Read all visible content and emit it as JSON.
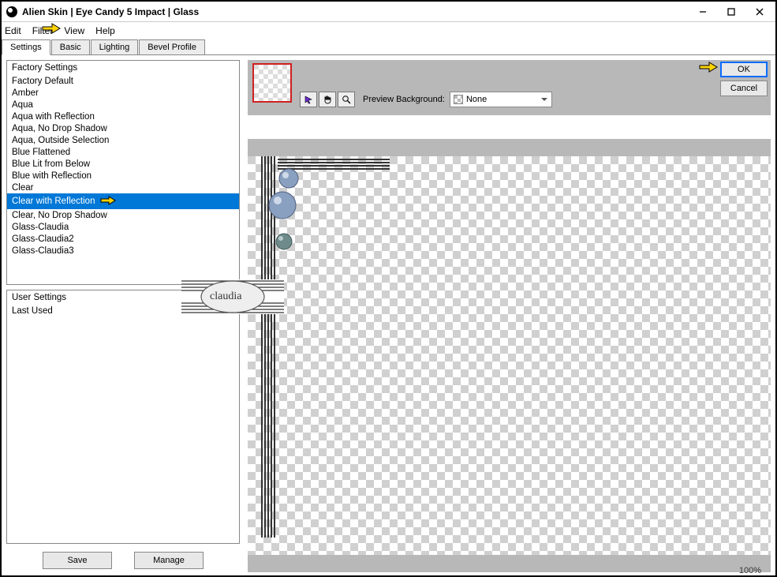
{
  "window": {
    "title": "Alien Skin | Eye Candy 5 Impact | Glass"
  },
  "menu": {
    "edit": "Edit",
    "filter": "Filter",
    "view": "View",
    "help": "Help"
  },
  "tabs": {
    "settings": "Settings",
    "basic": "Basic",
    "lighting": "Lighting",
    "bevel": "Bevel Profile"
  },
  "factory": {
    "header": "Factory Settings",
    "items": [
      "Factory Default",
      "Amber",
      "Aqua",
      "Aqua with Reflection",
      "Aqua, No Drop Shadow",
      "Aqua, Outside Selection",
      "Blue Flattened",
      "Blue Lit from Below",
      "Blue with Reflection",
      "Clear",
      "Clear with Reflection",
      "Clear, No Drop Shadow",
      "Glass-Claudia",
      "Glass-Claudia2",
      "Glass-Claudia3"
    ],
    "selected_index": 10
  },
  "user": {
    "header": "User Settings",
    "items": [
      "Last Used"
    ]
  },
  "buttons": {
    "save": "Save",
    "manage": "Manage",
    "ok": "OK",
    "cancel": "Cancel"
  },
  "preview": {
    "label": "Preview Background:",
    "value": "None",
    "zoom": "100%"
  },
  "watermark": "claudia"
}
